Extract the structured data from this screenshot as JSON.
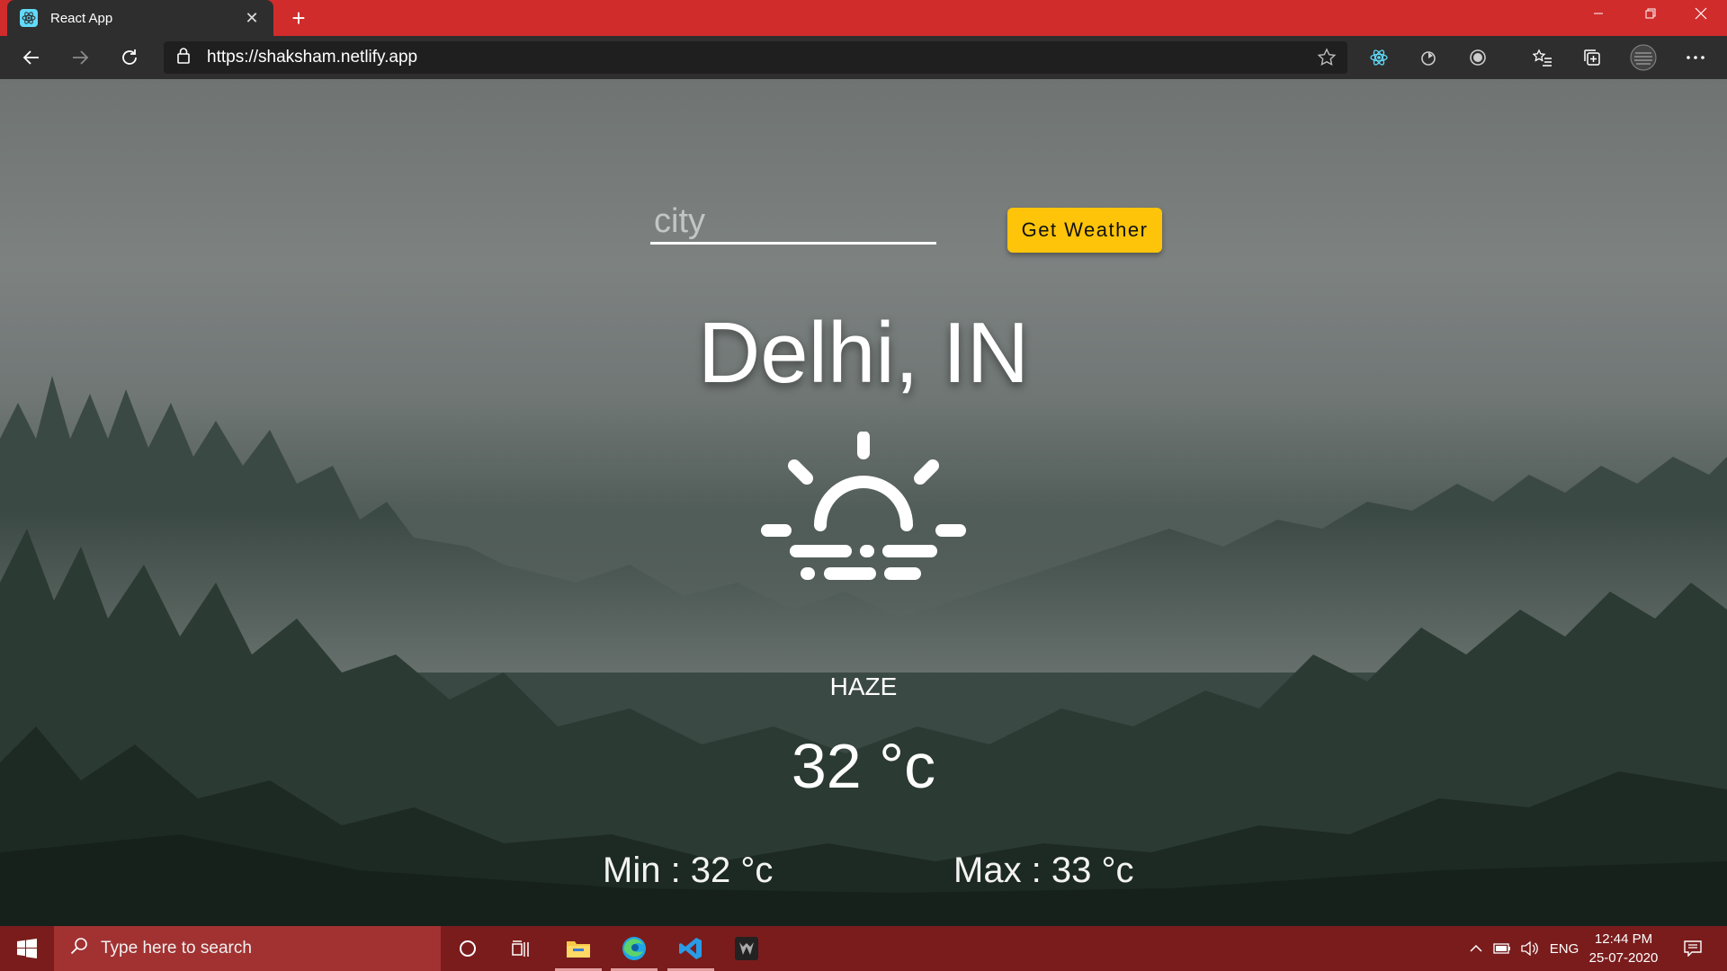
{
  "browser": {
    "tab_title": "React App",
    "url": "https://shaksham.netlify.app"
  },
  "page": {
    "city_placeholder": "city",
    "button_label": "Get Weather",
    "location": "Delhi, IN",
    "condition": "HAZE",
    "temperature": "32 °c",
    "min_temp": "Min : 32 °c",
    "max_temp": "Max : 33 °c",
    "weather_icon": "sunrise-haze-icon"
  },
  "taskbar": {
    "search_placeholder": "Type here to search",
    "language": "ENG",
    "time": "12:44 PM",
    "date": "25-07-2020"
  },
  "colors": {
    "titlebar": "#d02c2c",
    "toolbar": "#2e2e2e",
    "button": "#fdc40a",
    "taskbar": "#7a1c1c"
  }
}
